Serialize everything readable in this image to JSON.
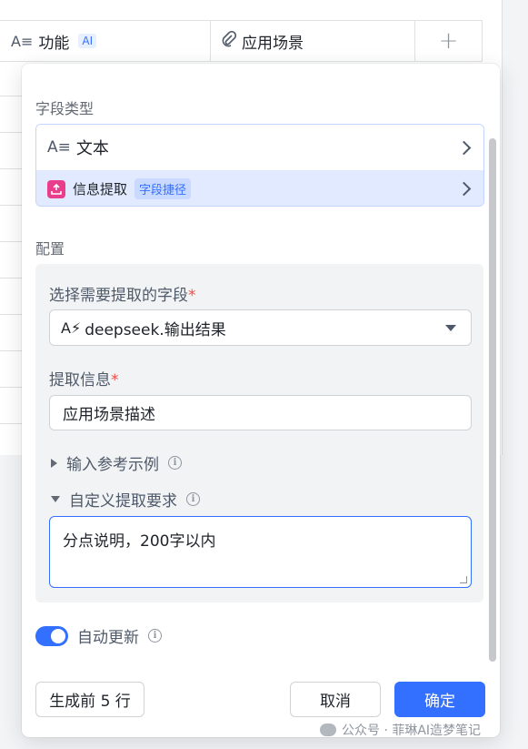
{
  "table": {
    "columns": [
      {
        "icon": "text-field-icon",
        "label": "功能",
        "badge": "AI"
      },
      {
        "icon": "attachment-icon",
        "label": "应用场景"
      }
    ],
    "add_column": "+"
  },
  "panel": {
    "field_type_title": "字段类型",
    "field_type": {
      "label": "文本"
    },
    "extension": {
      "label": "信息提取",
      "tag": "字段捷径"
    },
    "config_title": "配置",
    "source_field": {
      "label": "选择需要提取的字段",
      "required": "*",
      "value": "deepseek.输出结果"
    },
    "extract_info": {
      "label": "提取信息",
      "required": "*",
      "value": "应用场景描述"
    },
    "examples": {
      "label": "输入参考示例",
      "info": "i"
    },
    "custom_req": {
      "label": "自定义提取要求",
      "info": "i",
      "value": "分点说明，200字以内"
    },
    "auto_update": {
      "label": "自动更新",
      "info": "i",
      "enabled": true
    },
    "generate_button": "生成前 5 行",
    "cancel_button": "取消",
    "confirm_button": "确定"
  },
  "watermark": {
    "text": "公众号 · 菲琳AI造梦笔记"
  },
  "colors": {
    "accent": "#3370ff",
    "required": "#f54a45",
    "extension_icon": "#e83e8c"
  }
}
